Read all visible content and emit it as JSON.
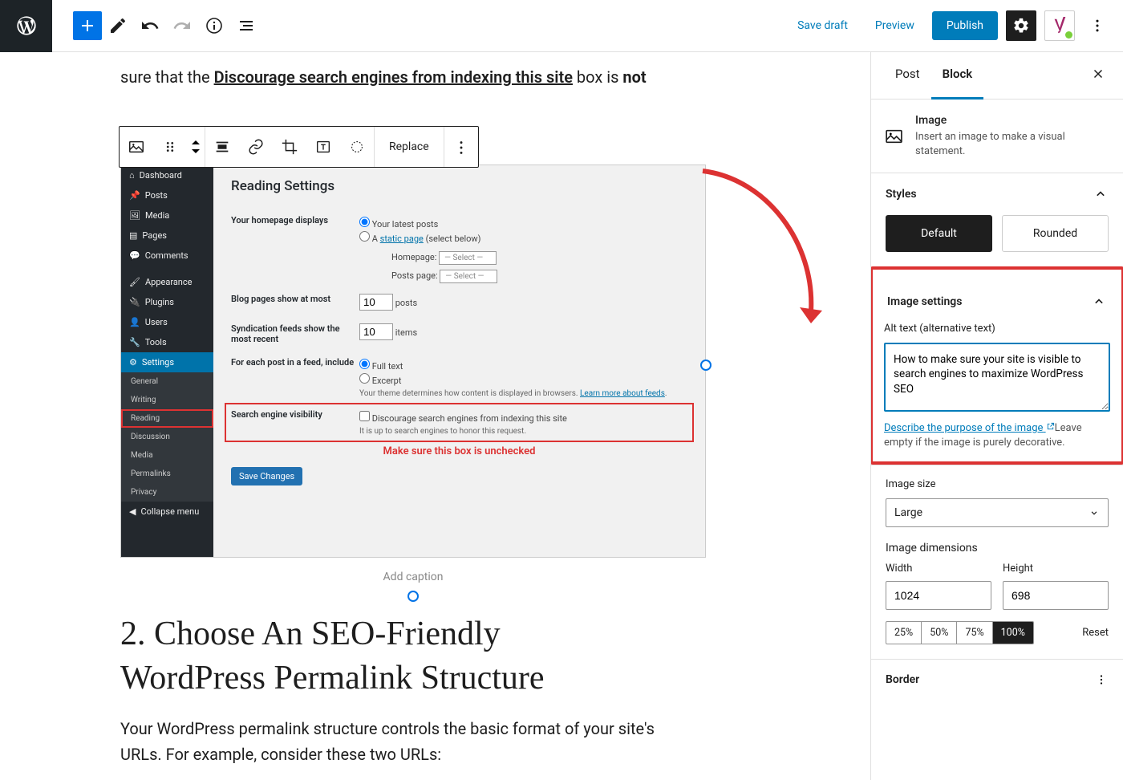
{
  "topbar": {
    "save_draft": "Save draft",
    "preview": "Preview",
    "publish": "Publish"
  },
  "block_toolbar": {
    "replace": "Replace"
  },
  "content": {
    "partial_before": "sure that the ",
    "partial_underline": "Discourage search engines from indexing this site",
    "partial_mid": " box is ",
    "partial_bold": "not",
    "caption_placeholder": "Add caption",
    "heading": "2. Choose An SEO-Friendly WordPress Permalink Structure",
    "paragraph": "Your WordPress permalink structure controls the basic format of your site's URLs. For example, consider these two URLs:"
  },
  "mock": {
    "title": "Reading Settings",
    "menu": [
      "Dashboard",
      "Posts",
      "Media",
      "Pages",
      "Comments",
      "Appearance",
      "Plugins",
      "Users",
      "Tools",
      "Settings"
    ],
    "submenu": [
      "General",
      "Writing",
      "Reading",
      "Discussion",
      "Media",
      "Permalinks",
      "Privacy"
    ],
    "collapse": "Collapse menu",
    "hp_label": "Your homepage displays",
    "hp_opt1": "Your latest posts",
    "hp_opt2_a": "A ",
    "hp_opt2_link": "static page",
    "hp_opt2_b": " (select below)",
    "homepage_lbl": "Homepage:",
    "postspage_lbl": "Posts page:",
    "select_ph": "— Select —",
    "blogpages_lbl": "Blog pages show at most",
    "blogpages_val": "10",
    "blogpages_unit": "posts",
    "synd_lbl": "Syndication feeds show the most recent",
    "synd_val": "10",
    "synd_unit": "items",
    "feed_lbl": "For each post in a feed, include",
    "feed_opt1": "Full text",
    "feed_opt2": "Excerpt",
    "feed_note": "Your theme determines how content is displayed in browsers. ",
    "feed_link": "Learn more about feeds",
    "sev_lbl": "Search engine visibility",
    "sev_check": "Discourage search engines from indexing this site",
    "sev_note": "It is up to search engines to honor this request.",
    "red_text": "Make sure this box is unchecked",
    "save": "Save Changes"
  },
  "sidebar": {
    "tab_post": "Post",
    "tab_block": "Block",
    "block_type": "Image",
    "block_desc": "Insert an image to make a visual statement.",
    "styles_hd": "Styles",
    "style_default": "Default",
    "style_rounded": "Rounded",
    "img_settings_hd": "Image settings",
    "alt_label": "Alt text (alternative text)",
    "alt_value": "How to make sure your site is visible to search engines to maximize WordPress SEO",
    "alt_link": "Describe the purpose of the image",
    "alt_help": "Leave empty if the image is purely decorative.",
    "size_label": "Image size",
    "size_value": "Large",
    "dim_hd": "Image dimensions",
    "width_lbl": "Width",
    "width_val": "1024",
    "height_lbl": "Height",
    "height_val": "698",
    "pct": [
      "25%",
      "50%",
      "75%",
      "100%"
    ],
    "reset": "Reset",
    "border_hd": "Border"
  }
}
